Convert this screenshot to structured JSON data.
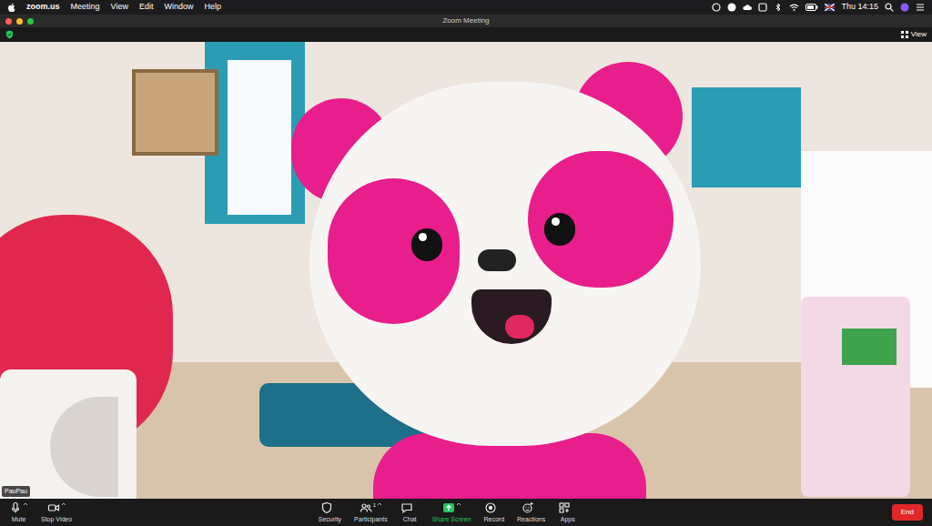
{
  "menu_bar": {
    "app": "zoom.us",
    "items": [
      "Meeting",
      "View",
      "Edit",
      "Window",
      "Help"
    ],
    "clock": "Thu 14:15"
  },
  "window": {
    "title": "Zoom Meeting"
  },
  "view_button": {
    "label": "View"
  },
  "video": {
    "participant": "PauPau"
  },
  "toolbar": {
    "items": [
      {
        "label": "Mute",
        "group": "left",
        "has_menu": true,
        "highlighted": false
      },
      {
        "label": "Stop Video",
        "group": "left",
        "has_menu": true,
        "highlighted": false
      },
      {
        "label": "Security",
        "group": "center",
        "has_menu": false,
        "highlighted": false
      },
      {
        "label": "Participants",
        "group": "center",
        "has_menu": true,
        "highlighted": false,
        "count": "1"
      },
      {
        "label": "Chat",
        "group": "center",
        "has_menu": false,
        "highlighted": false
      },
      {
        "label": "Share Screen",
        "group": "center",
        "has_menu": true,
        "highlighted": true
      },
      {
        "label": "Record",
        "group": "center",
        "has_menu": false,
        "highlighted": false
      },
      {
        "label": "Reactions",
        "group": "center",
        "has_menu": false,
        "highlighted": false
      },
      {
        "label": "Apps",
        "group": "center",
        "has_menu": false,
        "highlighted": false
      }
    ],
    "end": "End"
  }
}
